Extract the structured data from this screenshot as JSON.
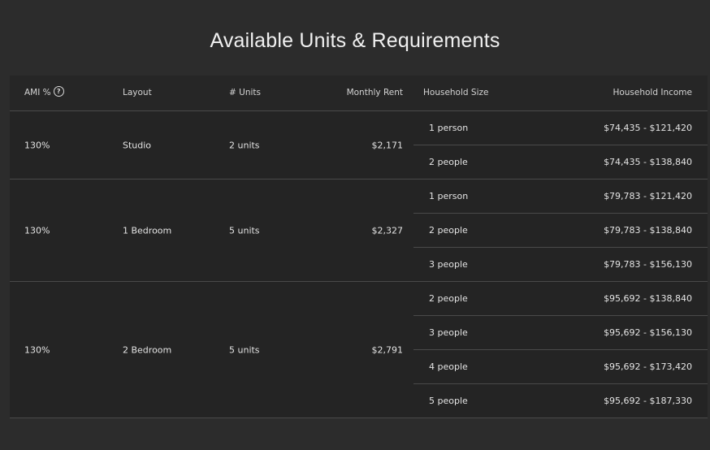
{
  "page": {
    "title": "Available Units & Requirements"
  },
  "table": {
    "headers": {
      "ami": "AMI %",
      "layout": "Layout",
      "units": "# Units",
      "rent": "Monthly Rent",
      "household_size": "Household Size",
      "household_income": "Household Income"
    },
    "help_icon_glyph": "?",
    "groups": [
      {
        "ami": "130%",
        "layout": "Studio",
        "units": "2 units",
        "rent": "$2,171",
        "rows": [
          {
            "size": "1 person",
            "income": "$74,435 - $121,420"
          },
          {
            "size": "2 people",
            "income": "$74,435 - $138,840"
          }
        ]
      },
      {
        "ami": "130%",
        "layout": "1 Bedroom",
        "units": "5 units",
        "rent": "$2,327",
        "rows": [
          {
            "size": "1 person",
            "income": "$79,783 - $121,420"
          },
          {
            "size": "2 people",
            "income": "$79,783 - $138,840"
          },
          {
            "size": "3 people",
            "income": "$79,783 - $156,130"
          }
        ]
      },
      {
        "ami": "130%",
        "layout": "2 Bedroom",
        "units": "5 units",
        "rent": "$2,791",
        "rows": [
          {
            "size": "2 people",
            "income": "$95,692 - $138,840"
          },
          {
            "size": "3 people",
            "income": "$95,692 - $156,130"
          },
          {
            "size": "4 people",
            "income": "$95,692 - $173,420"
          },
          {
            "size": "5 people",
            "income": "$95,692 - $187,330"
          }
        ]
      }
    ]
  }
}
